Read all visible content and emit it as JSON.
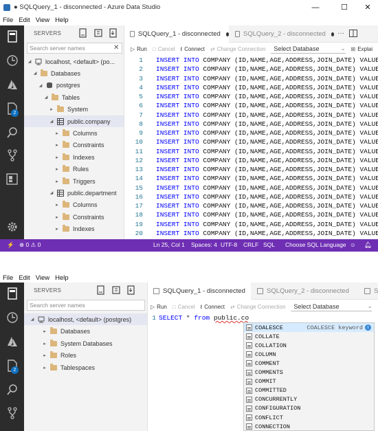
{
  "window": {
    "title": "● SQLQuery_1 - disconnected - Azure Data Studio",
    "minimize_glyph": "—",
    "maximize_glyph": "☐",
    "close_glyph": "✕"
  },
  "menu": [
    "File",
    "Edit",
    "View",
    "Help"
  ],
  "sidebar": {
    "header": "SERVERS",
    "search_placeholder": "Search server names"
  },
  "screen1": {
    "tree": [
      {
        "label": "localhost, <default> (po...",
        "level": 0,
        "icon": "server-icon",
        "chevron": "expanded"
      },
      {
        "label": "Databases",
        "level": 1,
        "icon": "folder-icon",
        "chevron": "expanded"
      },
      {
        "label": "postgres",
        "level": 2,
        "icon": "database-icon",
        "chevron": "expanded"
      },
      {
        "label": "Tables",
        "level": 3,
        "icon": "folder-icon",
        "chevron": "expanded"
      },
      {
        "label": "System",
        "level": 4,
        "icon": "folder-icon",
        "chevron": "collapsed"
      },
      {
        "label": "public.company",
        "level": 4,
        "icon": "table-icon",
        "chevron": "expanded",
        "selected": true
      },
      {
        "label": "Columns",
        "level": 5,
        "icon": "folder-icon",
        "chevron": "collapsed"
      },
      {
        "label": "Constraints",
        "level": 5,
        "icon": "folder-icon",
        "chevron": "collapsed"
      },
      {
        "label": "Indexes",
        "level": 5,
        "icon": "folder-icon",
        "chevron": "collapsed"
      },
      {
        "label": "Rules",
        "level": 5,
        "icon": "folder-icon",
        "chevron": "collapsed"
      },
      {
        "label": "Triggers",
        "level": 5,
        "icon": "folder-icon",
        "chevron": "collapsed"
      },
      {
        "label": "public.department",
        "level": 4,
        "icon": "table-icon",
        "chevron": "expanded"
      },
      {
        "label": "Columns",
        "level": 5,
        "icon": "folder-icon",
        "chevron": "collapsed"
      },
      {
        "label": "Constraints",
        "level": 5,
        "icon": "folder-icon",
        "chevron": "collapsed"
      },
      {
        "label": "Indexes",
        "level": 5,
        "icon": "folder-icon",
        "chevron": "collapsed"
      }
    ],
    "tabs": [
      {
        "label": "SQLQuery_1 - disconnected",
        "active": true,
        "modified": true
      },
      {
        "label": "SQLQuery_2 - disconnected",
        "active": false,
        "modified": true
      }
    ],
    "toolbar": {
      "run": "Run",
      "cancel": "Cancel",
      "connect": "Connect",
      "change_connection": "Change Connection",
      "select_database": "Select Database",
      "explain": "Explai"
    },
    "code_prefix": "INSERT INTO",
    "code_rest": "COMPANY (ID,NAME,AGE,ADDRESS,JOIN_DATE) VALUES (",
    "line_count": 20,
    "status": {
      "errors": "0",
      "warnings": "0",
      "position": "Ln 25, Col 1",
      "spaces": "Spaces: 4",
      "encoding": "UTF-8",
      "eol": "CRLF",
      "language": "SQL",
      "choose_language": "Choose SQL Language"
    }
  },
  "screen2": {
    "tree": [
      {
        "label": "localhost, <default> (postgres)",
        "level": 0,
        "icon": "server-icon",
        "chevron": "expanded",
        "selected": true
      },
      {
        "label": "Databases",
        "level": 1,
        "icon": "folder-icon",
        "chevron": "collapsed"
      },
      {
        "label": "System Databases",
        "level": 1,
        "icon": "folder-icon",
        "chevron": "collapsed"
      },
      {
        "label": "Roles",
        "level": 1,
        "icon": "folder-icon",
        "chevron": "collapsed"
      },
      {
        "label": "Tablespaces",
        "level": 1,
        "icon": "folder-icon",
        "chevron": "collapsed"
      }
    ],
    "tabs": [
      {
        "label": "SQLQuery_1 - disconnected",
        "active": true
      },
      {
        "label": "SQLQuery_2 - disconnected",
        "active": false
      },
      {
        "label": "S",
        "active": false
      }
    ],
    "toolbar": {
      "run": "Run",
      "cancel": "Cancel",
      "connect": "Connect",
      "change_connection": "Change Connection",
      "select_database": "Select Database"
    },
    "code_line_number": "1",
    "code_keyword1": "SELECT",
    "code_star": "*",
    "code_keyword2": "from",
    "code_ident": "public.co",
    "suggestion_detail": "COALESCE keyword",
    "suggestions": [
      "COALESCE",
      "COLLATE",
      "COLLATION",
      "COLUMN",
      "COMMENT",
      "COMMENTS",
      "COMMIT",
      "COMMITTED",
      "CONCURRENTLY",
      "CONFIGURATION",
      "CONFLICT",
      "CONNECTION"
    ]
  },
  "colors": {
    "activity_bar": "#2c2c2c",
    "status_bar": "#6f2fb4",
    "keyword": "#0000ff",
    "line_number": "#237893",
    "badge": "#0e70c0"
  }
}
